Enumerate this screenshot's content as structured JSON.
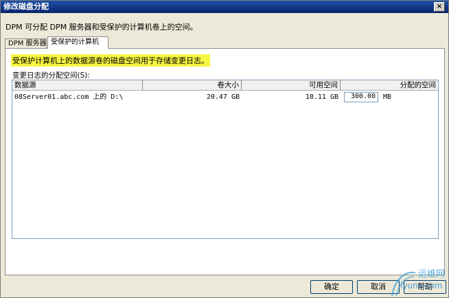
{
  "window": {
    "title": "修改磁盘分配",
    "close_glyph": "×"
  },
  "description": "DPM 可分配 DPM 服务器和受保护的计算机卷上的空间。",
  "tabs": [
    {
      "label": "DPM 服务器",
      "active": false
    },
    {
      "label": "受保护的计算机",
      "active": true
    }
  ],
  "panel": {
    "highlight_text": "受保护计算机上的数据源卷的磁盘空间用于存储变更日志。",
    "allocation_label": "变更日志的分配空间(S):",
    "columns": [
      "数据源",
      "卷大小",
      "可用空间",
      "分配的空间"
    ],
    "rows": [
      {
        "source": "08Server01.abc.com 上的 D:\\",
        "volume_size": "20.47 GB",
        "free_space": "18.11 GB",
        "allocated": "300.00",
        "unit": "MB"
      }
    ]
  },
  "buttons": {
    "ok": "确定",
    "cancel": "取消",
    "help": "帮助"
  },
  "watermark": {
    "text": "运维网",
    "url": "iyunv.com"
  },
  "colors": {
    "title_bar": "#0a246a",
    "highlight": "#f5f542",
    "window_bg": "#ece9d8"
  }
}
